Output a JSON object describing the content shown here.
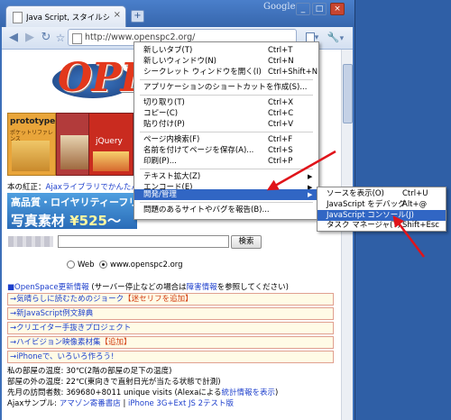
{
  "window": {
    "tab_title": "Java Script, スタイルシート, ...",
    "tab_close": "×",
    "new_tab": "+",
    "brand": "Google",
    "minimize": "_",
    "maximize": "□",
    "close": "×"
  },
  "toolbar": {
    "back": "◀",
    "forward": "▶",
    "reload": "↻",
    "star": "☆",
    "url": "http://www.openspc2.org/",
    "page_menu": "▾",
    "tools_menu": "▾"
  },
  "content": {
    "logo": "OPE",
    "book1_title": "prototype.js",
    "book1_sub": "ポケットリファレンス",
    "book2_title": "jQuery",
    "pick_prefix": "本の紅正：",
    "pick_link": "Ajaxライブラリでかんたんイ",
    "banner_line1": "高品質・ロイヤリティーフリ",
    "banner_line2_a": "写真素材 ",
    "banner_line2_b": "¥525",
    "banner_line2_c": "～",
    "search_button": "検索",
    "radio_web": "Web",
    "radio_site": "www.openspc2.org",
    "section_link": "■OpenSpace",
    "section_link2": "更新情報",
    "section_rest": " (サーバー停止などの場合は",
    "section_link3": "障害情報",
    "section_rest2": "を参照してください)",
    "news": [
      {
        "text": "→気晴らしに読むためのジョーク",
        "tag": "【迷セリフを追加】"
      },
      {
        "text": "→新JavaScript例文辞典",
        "tag": ""
      },
      {
        "text": "→クリエイター手抜きプロジェクト",
        "tag": ""
      },
      {
        "text": "→ハイビジョン映像素材集",
        "tag": "【追加】"
      },
      {
        "text": "→iPhoneで、いろいろ作ろう!",
        "tag": ""
      }
    ],
    "line1": "私の部屋の温度: 30℃(2階の部屋の足下の温度)",
    "line2": "部屋の外の温度: 22℃(東向きで直射日光が当たる状態で計測)",
    "line3_a": "先月の訪問者数: 369680+8011 unique visits (Alexaによる",
    "line3_b": "統計情報を表示",
    "line3_c": ")",
    "line4_a": "Ajaxサンプル: ",
    "line4_b": "アマゾン寄番書店",
    "line4_c": " | ",
    "line4_d": "iPhone 3G+Ext JS 2テスト版"
  },
  "menu": {
    "items": [
      {
        "label": "新しいタブ(T)",
        "shortcut": "Ctrl+T"
      },
      {
        "label": "新しいウィンドウ(N)",
        "shortcut": "Ctrl+N"
      },
      {
        "label": "シークレット ウィンドウを開く(I)",
        "shortcut": "Ctrl+Shift+N"
      },
      {
        "label": "アプリケーションのショートカットを作成(S)...",
        "shortcut": ""
      },
      {
        "label": "切り取り(T)",
        "shortcut": "Ctrl+X"
      },
      {
        "label": "コピー(C)",
        "shortcut": "Ctrl+C"
      },
      {
        "label": "貼り付け(P)",
        "shortcut": "Ctrl+V"
      },
      {
        "label": "ページ内検索(F)",
        "shortcut": "Ctrl+F"
      },
      {
        "label": "名前を付けてページを保存(A)...",
        "shortcut": "Ctrl+S"
      },
      {
        "label": "印刷(P)...",
        "shortcut": "Ctrl+P"
      },
      {
        "label": "テキスト拡大(Z)",
        "shortcut": ""
      },
      {
        "label": "エンコード(E)",
        "shortcut": ""
      },
      {
        "label": "開発/管理",
        "shortcut": ""
      },
      {
        "label": "問題のあるサイトやバグを報告(B)...",
        "shortcut": ""
      }
    ],
    "submenu_arrow": "▶"
  },
  "submenu": {
    "items": [
      {
        "label": "ソースを表示(O)",
        "shortcut": "Ctrl+U"
      },
      {
        "label": "JavaScript をデバッグ",
        "shortcut": "Alt+@"
      },
      {
        "label": "JavaScript コンソール(J)",
        "shortcut": ""
      },
      {
        "label": "タスク マネージャ(T)",
        "shortcut": "Shift+Esc"
      }
    ]
  },
  "colors": {
    "highlight": "#3166c4",
    "arrow": "#e0141a"
  }
}
